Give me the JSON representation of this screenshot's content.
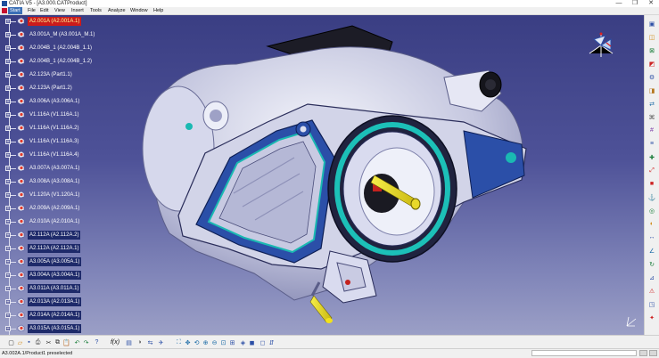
{
  "window": {
    "title": "CATIA V5 - [A3.000.CATProduct]",
    "controls": {
      "minimize": "—",
      "maximize": "❐",
      "close": "✕"
    }
  },
  "menu": {
    "items": [
      {
        "label": "Start",
        "active": true
      },
      {
        "label": "File"
      },
      {
        "label": "Edit"
      },
      {
        "label": "View"
      },
      {
        "label": "Insert"
      },
      {
        "label": "Tools"
      },
      {
        "label": "Analyze"
      },
      {
        "label": "Window"
      },
      {
        "label": "Help"
      }
    ]
  },
  "tree": {
    "items": [
      {
        "label": "A2.001A (A2.001A.1)",
        "state": "highlighted"
      },
      {
        "label": "A3.001A_M (A3.001A_M.1)",
        "state": "normal"
      },
      {
        "label": "A2.004B_1 (A2.004B_1.1)",
        "state": "normal"
      },
      {
        "label": "A2.004B_1 (A2.004B_1.2)",
        "state": "normal"
      },
      {
        "label": "A2.123A (Part1.1)",
        "state": "normal"
      },
      {
        "label": "A2.123A (Part1.2)",
        "state": "normal"
      },
      {
        "label": "A3.006A (A3.006A.1)",
        "state": "normal"
      },
      {
        "label": "V1.116A (V1.116A.1)",
        "state": "normal"
      },
      {
        "label": "V1.116A (V1.116A.2)",
        "state": "normal"
      },
      {
        "label": "V1.116A (V1.116A.3)",
        "state": "normal"
      },
      {
        "label": "V1.116A (V1.116A.4)",
        "state": "normal"
      },
      {
        "label": "A3.007A (A3.007A.1)",
        "state": "normal"
      },
      {
        "label": "A3.008A (A3.008A.1)",
        "state": "normal"
      },
      {
        "label": "V1.120A (V1.120A.1)",
        "state": "normal"
      },
      {
        "label": "A2.009A (A2.009A.1)",
        "state": "normal"
      },
      {
        "label": "A2.010A (A2.010A.1)",
        "state": "normal"
      },
      {
        "label": "A2.112A (A2.112A.2)",
        "state": "selected"
      },
      {
        "label": "A2.112A (A2.112A.1)",
        "state": "selected"
      },
      {
        "label": "A3.005A (A3.005A.1)",
        "state": "selected"
      },
      {
        "label": "A3.004A (A3.004A.1)",
        "state": "selected"
      },
      {
        "label": "A3.011A (A3.011A.1)",
        "state": "selected"
      },
      {
        "label": "A2.013A (A2.013A.1)",
        "state": "selected"
      },
      {
        "label": "A2.014A (A2.014A.1)",
        "state": "selected"
      },
      {
        "label": "A3.015A (A3.015A.1)",
        "state": "selected"
      }
    ]
  },
  "toolbar_right": {
    "icons": [
      "product-icon",
      "sketch-icon",
      "constraint-icon",
      "assembly-icon",
      "component-icon",
      "existing-component-icon",
      "replace-icon",
      "graph-tree-icon",
      "generate-numbering-icon",
      "bill-of-material-icon",
      "snap-icon",
      "explode-icon",
      "stop-manipulate-icon",
      "constraint-fix-icon",
      "coincidence-icon",
      "contact-icon",
      "offset-icon",
      "angle-icon",
      "update-icon",
      "measure-icon",
      "clash-icon",
      "section-icon",
      "catia-logo-icon"
    ]
  },
  "toolbar_bottom": {
    "icons": [
      "new-icon",
      "open-icon",
      "save-icon",
      "print-icon",
      "cut-icon",
      "copy-icon",
      "paste-icon",
      "undo-icon",
      "redo-icon",
      "whats-this-icon",
      "formula-icon",
      "catalog-icon",
      "hide-show-icon",
      "swap-icon",
      "fly-mode-icon",
      "fit-all-icon",
      "pan-icon",
      "rotate-icon",
      "zoom-in-icon",
      "zoom-out-icon",
      "normal-view-icon",
      "multi-view-icon",
      "iso-view-icon",
      "shading-icon",
      "hide-icon",
      "swap-visible-icon"
    ],
    "formula_label": "f(x)"
  },
  "status": {
    "text": "A3.002A.1/Product1 preselected"
  },
  "colors": {
    "background_top": "#3a3e83",
    "background_bottom": "#9b9fc6",
    "selection": "#1e2a6a",
    "highlight": "#cc1b1b",
    "part_body": "#c9cbe3",
    "part_accent_teal": "#19b8b2",
    "part_accent_blue": "#2c4fa6",
    "part_accent_yellow": "#f2e21b"
  }
}
